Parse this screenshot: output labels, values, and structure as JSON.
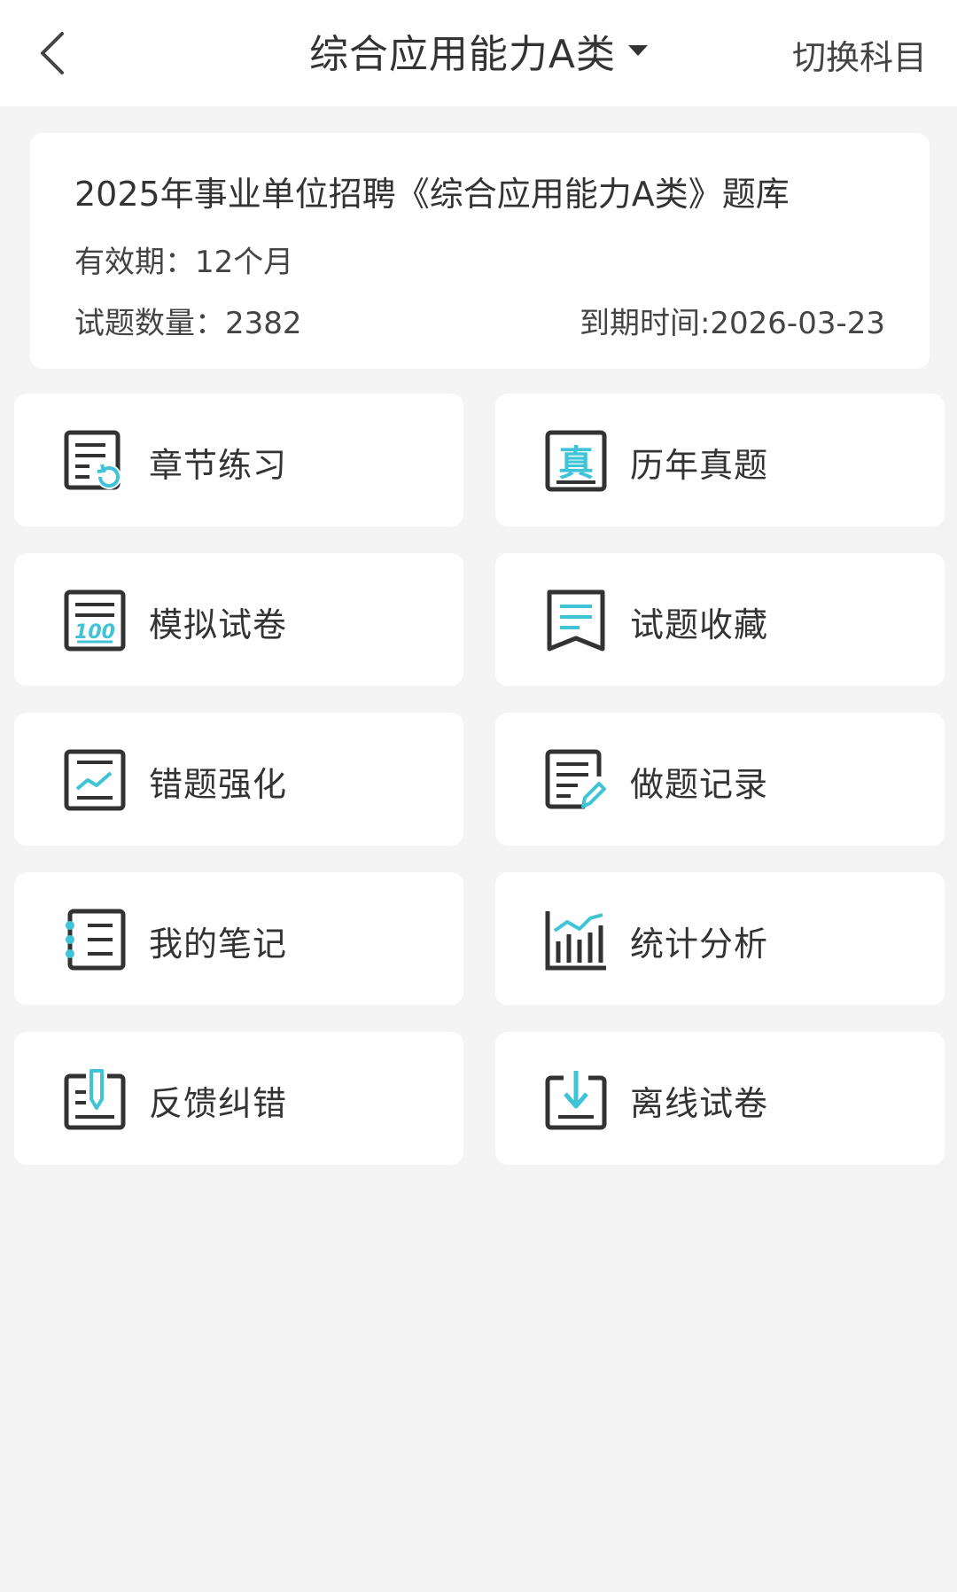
{
  "header": {
    "title": "综合应用能力A类",
    "switch_label": "切换科目"
  },
  "info": {
    "title": "2025年事业单位招聘《综合应用能力A类》题库",
    "valid": "有效期：12个月",
    "count": "试题数量：2382",
    "expire": "到期时间:2026-03-23"
  },
  "menu": [
    {
      "label": "章节练习",
      "icon": "chapter-practice-icon"
    },
    {
      "label": "历年真题",
      "icon": "past-exams-icon"
    },
    {
      "label": "模拟试卷",
      "icon": "mock-exam-icon"
    },
    {
      "label": "试题收藏",
      "icon": "favorites-icon"
    },
    {
      "label": "错题强化",
      "icon": "wrong-questions-icon"
    },
    {
      "label": "做题记录",
      "icon": "practice-record-icon"
    },
    {
      "label": "我的笔记",
      "icon": "notes-icon"
    },
    {
      "label": "统计分析",
      "icon": "statistics-icon"
    },
    {
      "label": "反馈纠错",
      "icon": "feedback-icon"
    },
    {
      "label": "离线试卷",
      "icon": "offline-exam-icon"
    }
  ],
  "colors": {
    "accent": "#3fc3d6",
    "icon_stroke": "#333333",
    "background": "#f4f4f4"
  }
}
